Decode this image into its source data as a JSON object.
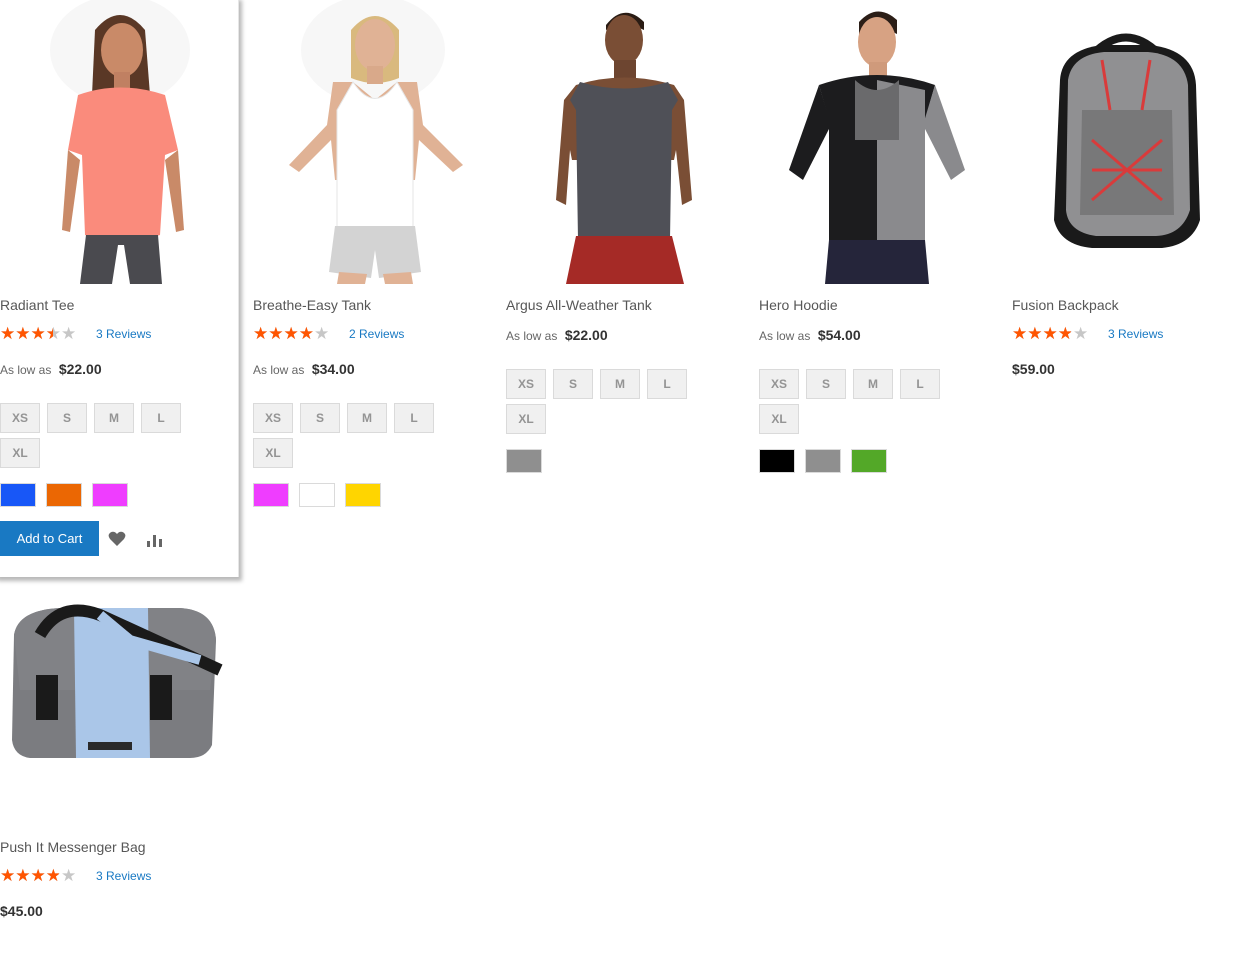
{
  "products": [
    {
      "name": "Radiant Tee",
      "rating_pct": 60,
      "reviews": "3 Reviews",
      "price_prefix": "As low as",
      "price": "$22.00",
      "sizes": [
        "XS",
        "S",
        "M",
        "L",
        "XL"
      ],
      "colors": [
        "#1857f7",
        "#eb6703",
        "#ef3dff"
      ],
      "add_to_cart": "Add to Cart",
      "hovered": true
    },
    {
      "name": "Breathe-Easy Tank",
      "rating_pct": 70,
      "reviews": "2 Reviews",
      "price_prefix": "As low as",
      "price": "$34.00",
      "sizes": [
        "XS",
        "S",
        "M",
        "L",
        "XL"
      ],
      "colors": [
        "#ef3dff",
        "#ffffff",
        "#ffd500"
      ]
    },
    {
      "name": "Argus All-Weather Tank",
      "price_prefix": "As low as",
      "price": "$22.00",
      "sizes": [
        "XS",
        "S",
        "M",
        "L",
        "XL"
      ],
      "colors": [
        "#8f8f8f"
      ]
    },
    {
      "name": "Hero Hoodie",
      "price_prefix": "As low as",
      "price": "$54.00",
      "sizes": [
        "XS",
        "S",
        "M",
        "L",
        "XL"
      ],
      "colors": [
        "#000000",
        "#8f8f8f",
        "#53a828"
      ]
    },
    {
      "name": "Fusion Backpack",
      "rating_pct": 67,
      "reviews": "3 Reviews",
      "price": "$59.00"
    },
    {
      "name": "Push It Messenger Bag",
      "rating_pct": 67,
      "reviews": "3 Reviews",
      "price": "$45.00"
    }
  ],
  "icons": {
    "wishlist": "heart-icon",
    "compare": "bar-chart-icon"
  }
}
